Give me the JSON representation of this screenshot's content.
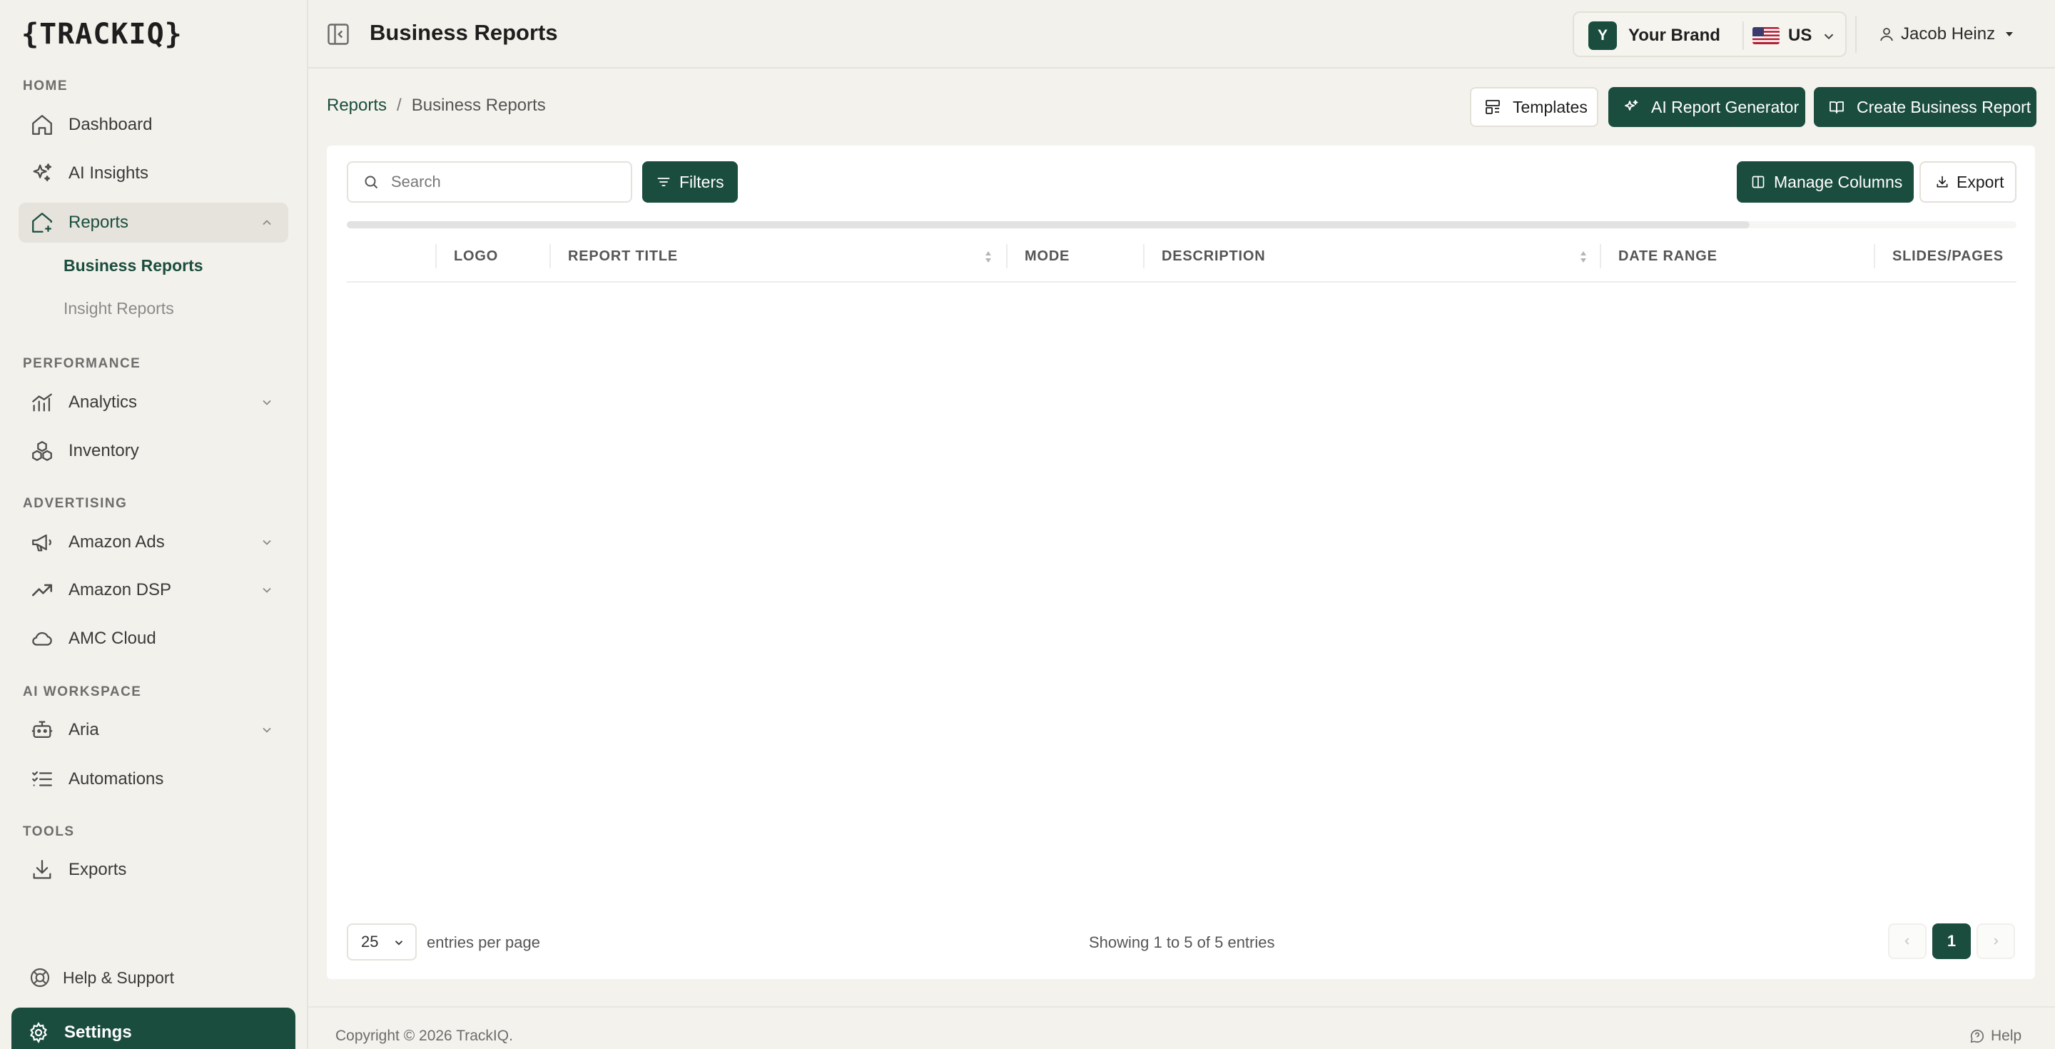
{
  "sidebar": {
    "logo": "{TRACKIQ}",
    "sections": {
      "home": "HOME",
      "performance": "PERFORMANCE",
      "advertising": "ADVERTISING",
      "ai_workspace": "AI WORKSPACE",
      "tools": "TOOLS"
    },
    "items": {
      "dashboard": "Dashboard",
      "ai_insights": "AI Insights",
      "reports": "Reports",
      "business_reports": "Business Reports",
      "insight_reports": "Insight Reports",
      "analytics": "Analytics",
      "inventory": "Inventory",
      "amazon_ads": "Amazon Ads",
      "amazon_dsp": "Amazon DSP",
      "amc_cloud": "AMC Cloud",
      "aria": "Aria",
      "automations": "Automations",
      "exports": "Exports"
    },
    "help_support": "Help & Support",
    "settings": "Settings"
  },
  "header": {
    "title": "Business Reports",
    "brand_initial": "Y",
    "brand_name": "Your Brand",
    "market": "US",
    "user_name": "Jacob Heinz"
  },
  "breadcrumb": {
    "parent": "Reports",
    "separator": "/",
    "current": "Business Reports"
  },
  "actions": {
    "templates": "Templates",
    "ai_report_generator": "AI Report Generator",
    "create_business_report": "Create Business Report"
  },
  "toolbar": {
    "search_placeholder": "Search",
    "filters": "Filters",
    "manage_columns": "Manage Columns",
    "export": "Export"
  },
  "table": {
    "columns": [
      "LOGO",
      "REPORT TITLE",
      "MODE",
      "DESCRIPTION",
      "DATE RANGE",
      "SLIDES/PAGES"
    ],
    "rows": []
  },
  "pagination": {
    "page_size": "25",
    "entries_label": "entries per page",
    "showing": "Showing 1 to 5 of 5 entries",
    "current_page": "1"
  },
  "footer": {
    "copyright": "Copyright © 2026 TrackIQ.",
    "help": "Help"
  },
  "colors": {
    "accent": "#1a4d3e",
    "background": "#f4f2ec",
    "card": "#ffffff"
  }
}
